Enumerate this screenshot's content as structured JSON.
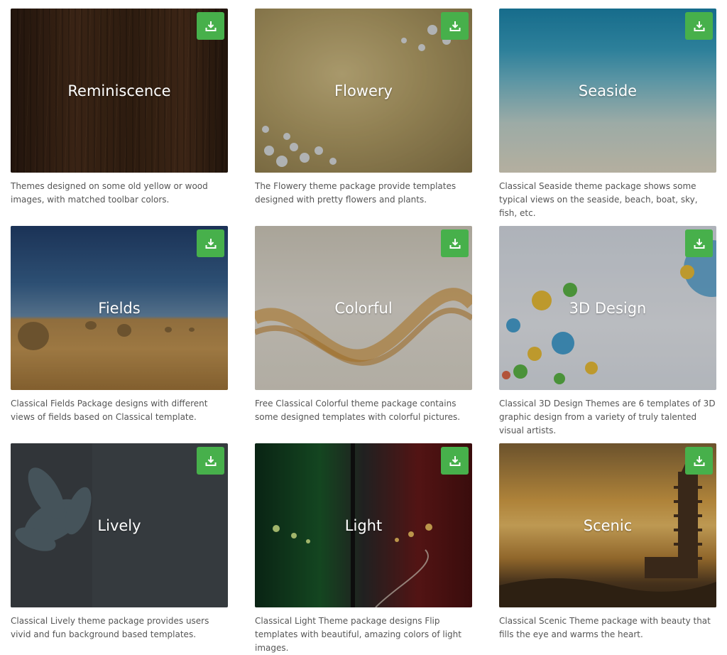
{
  "cards": [
    {
      "title": "Reminiscence",
      "desc": "Themes designed on some old yellow or wood images, with matched toolbar colors."
    },
    {
      "title": "Flowery",
      "desc": "The Flowery theme package provide templates designed with pretty flowers and plants."
    },
    {
      "title": "Seaside",
      "desc": "Classical Seaside theme package shows some typical views on the seaside, beach, boat, sky, fish, etc."
    },
    {
      "title": "Fields",
      "desc": "Classical Fields Package designs with different views of fields based on Classical template."
    },
    {
      "title": "Colorful",
      "desc": "Free Classical Colorful theme package contains some designed templates with colorful pictures."
    },
    {
      "title": "3D Design",
      "desc": "Classical 3D Design Themes are 6 templates of 3D graphic design from a variety of truly talented visual artists."
    },
    {
      "title": "Lively",
      "desc": "Classical Lively theme package provides users vivid and fun background based templates."
    },
    {
      "title": "Light",
      "desc": "Classical Light Theme package designs Flip templates with beautiful, amazing colors of light images."
    },
    {
      "title": "Scenic",
      "desc": "Classical Scenic Theme package with beauty that fills the eye and warms the heart."
    }
  ],
  "colors": {
    "download_button": "#47b04b",
    "description_text": "#555555",
    "title_text": "#ffffff"
  },
  "icons": {
    "download": "download-icon"
  }
}
